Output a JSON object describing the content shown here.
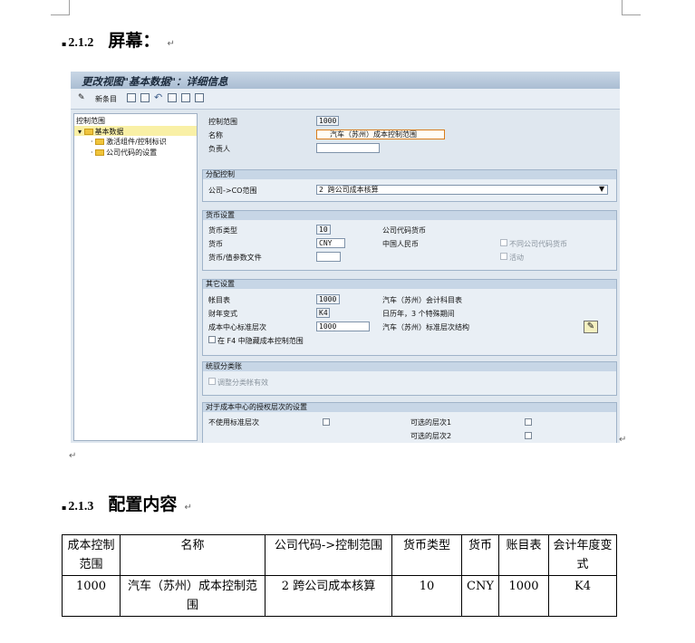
{
  "section_212": {
    "bullet": "▪",
    "number": "2.1.2",
    "title": "屏幕：",
    "para_mark": "↵"
  },
  "section_213": {
    "bullet": "▪",
    "number": "2.1.3",
    "title": "配置内容",
    "para_mark": "↵"
  },
  "after_screenshot_mark": "↵",
  "right_mark": "↵",
  "sap": {
    "window_title": "更改视图\"基本数据\"：详细信息",
    "toolbar": {
      "new_entries": "新条目"
    },
    "tree": {
      "header": "控制范围",
      "root": "基本数据",
      "items": [
        "激活组件/控制标识",
        "公司代码的设置"
      ]
    },
    "top": {
      "controlling_area_label": "控制范围",
      "controlling_area_value": "1000",
      "name_label": "名称",
      "name_value": "汽车（苏州）成本控制范围",
      "responsible_label": "负责人",
      "responsible_value": ""
    },
    "assignment": {
      "header": "分配控制",
      "cocd_label": "公司->CO范围",
      "cocd_value": "2 跨公司成本核算"
    },
    "currency": {
      "header": "货币设置",
      "type_label": "货币类型",
      "type_value": "10",
      "type_desc": "公司代码货币",
      "curr_label": "货币",
      "curr_value": "CNY",
      "curr_desc": "中国人民币",
      "profile_label": "货币/值参数文件",
      "profile_value": "",
      "diff_cocd_label": "不同公司代码货币",
      "active_label": "活动"
    },
    "other": {
      "header": "其它设置",
      "coa_label": "帐目表",
      "coa_value": "1000",
      "coa_desc": "汽车（苏州）会计科目表",
      "fy_label": "财年变式",
      "fy_value": "K4",
      "fy_desc": "日历年，3 个特殊期间",
      "std_label": "成本中心标准层次",
      "std_value": "1000",
      "std_desc": "汽车（苏州）标准层次结构",
      "hide_label": "在 F4 中隐藏成本控制范围"
    },
    "recon": {
      "header": "统驭分类账",
      "adjust_label": "调整分类帐有效"
    },
    "auth": {
      "header": "对于成本中心的授权层次的设置",
      "no_std_label": "不使用标准层次",
      "alt1_label": "可选的层次1",
      "alt2_label": "可选的层次2"
    }
  },
  "config_table": {
    "headers": [
      "成本控制范围",
      "名称",
      "公司代码->控制范围",
      "货币类型",
      "货币",
      "账目表",
      "会计年度变式"
    ],
    "rows": [
      [
        "1000",
        "汽车（苏州）成本控制范围",
        "2 跨公司成本核算",
        "10",
        "CNY",
        "1000",
        "K4"
      ]
    ]
  },
  "colors": {
    "title_bar": "#b9cadd",
    "panel": "#dfe7ef",
    "tree_selection": "#f9f0a6",
    "folder": "#f0c43c"
  }
}
